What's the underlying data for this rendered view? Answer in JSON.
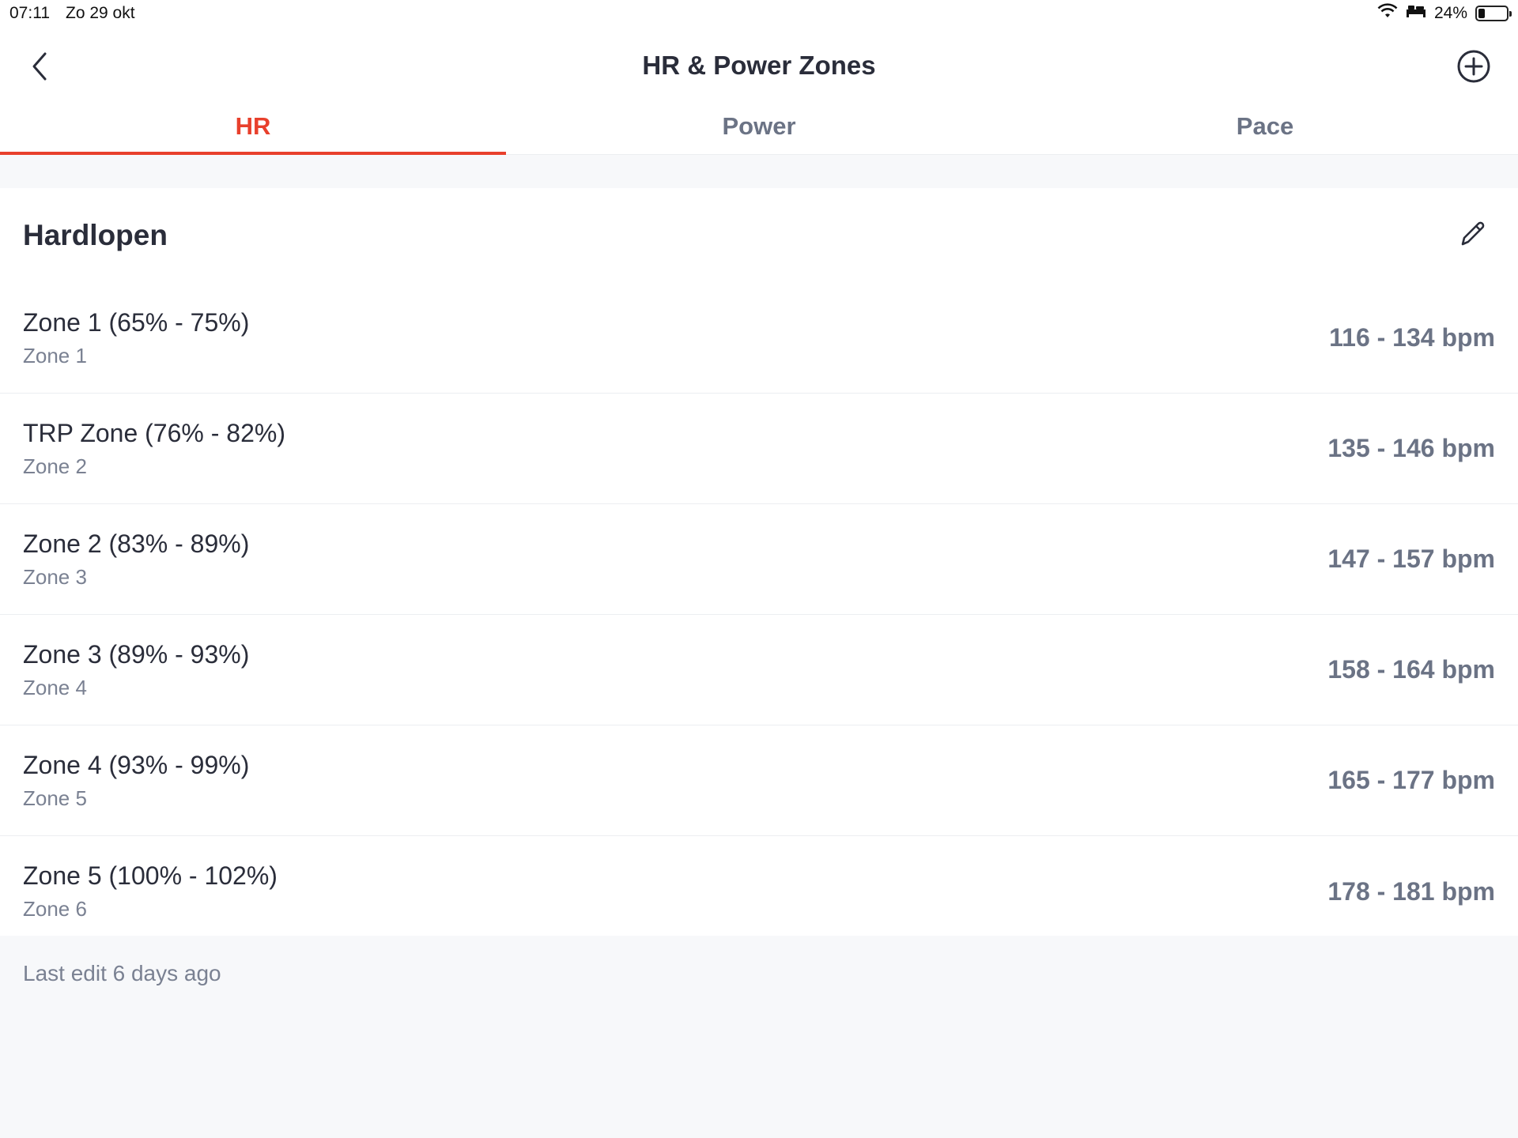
{
  "status": {
    "time": "07:11",
    "date": "Zo 29 okt",
    "battery": "24%",
    "battery_level": 0.24
  },
  "header": {
    "title": "HR & Power Zones",
    "back_icon": "chevron-left-icon",
    "add_icon": "plus-circle-icon"
  },
  "tabs": [
    {
      "label": "HR",
      "active": true
    },
    {
      "label": "Power",
      "active": false
    },
    {
      "label": "Pace",
      "active": false
    }
  ],
  "section": {
    "title": "Hardlopen",
    "edit_icon": "pencil-icon"
  },
  "zones": [
    {
      "name": "Zone 1 (65% - 75%)",
      "sub": "Zone 1",
      "range": "116 - 134 bpm"
    },
    {
      "name": "TRP Zone (76% - 82%)",
      "sub": "Zone 2",
      "range": "135 - 146 bpm"
    },
    {
      "name": "Zone 2 (83% - 89%)",
      "sub": "Zone 3",
      "range": "147 - 157 bpm"
    },
    {
      "name": "Zone 3 (89% - 93%)",
      "sub": "Zone 4",
      "range": "158 - 164 bpm"
    },
    {
      "name": "Zone 4 (93% - 99%)",
      "sub": "Zone 5",
      "range": "165 - 177 bpm"
    },
    {
      "name": "Zone 5 (100% - 102%)",
      "sub": "Zone 6",
      "range": "178 - 181 bpm"
    }
  ],
  "footer": {
    "note": "Last edit 6 days ago"
  },
  "colors": {
    "accent": "#e8402c",
    "text": "#2a2d3a",
    "muted": "#6b7385",
    "background": "#f7f8fa"
  }
}
